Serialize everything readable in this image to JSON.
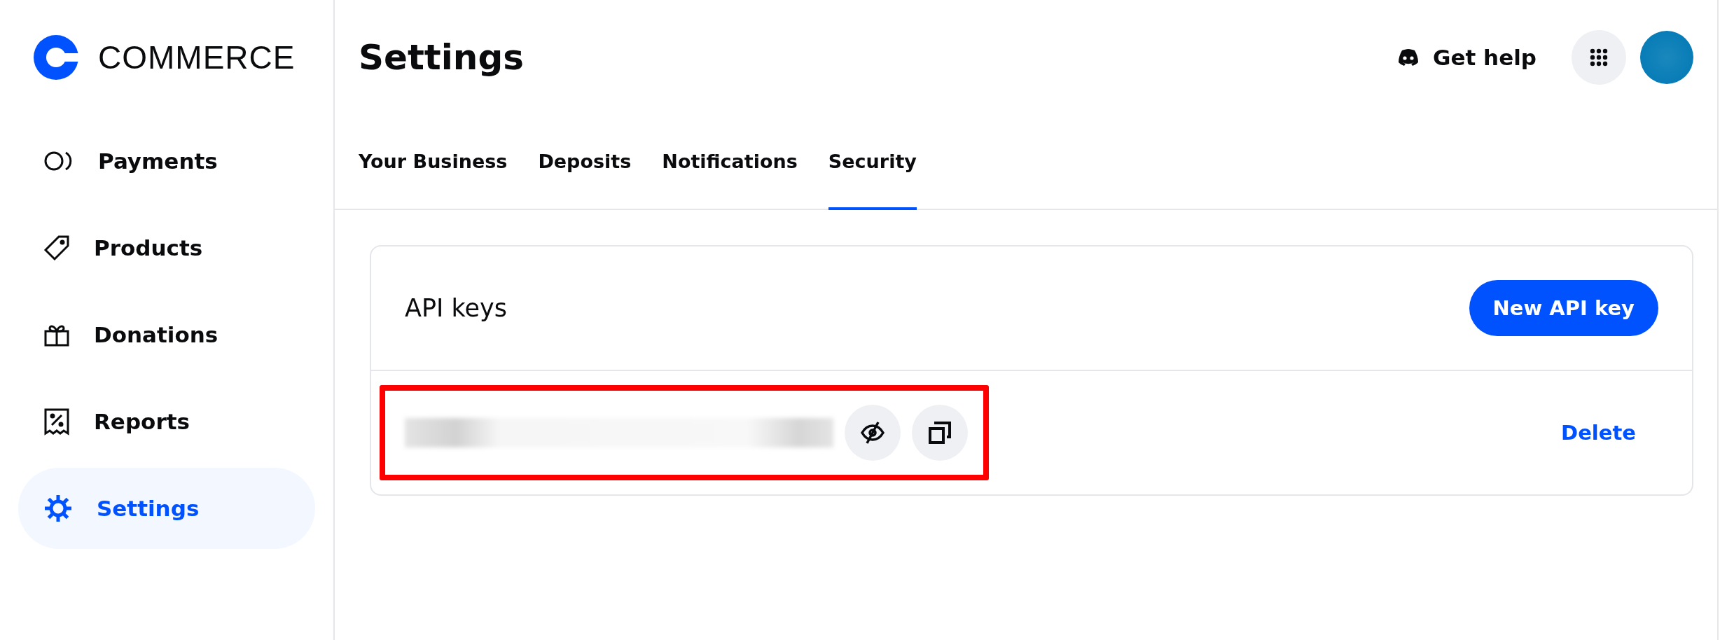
{
  "brand": {
    "name": "COMMERCE"
  },
  "sidebar": {
    "items": [
      {
        "label": "Payments",
        "kind": "payments",
        "selected": false
      },
      {
        "label": "Products",
        "kind": "products",
        "selected": false
      },
      {
        "label": "Donations",
        "kind": "donations",
        "selected": false
      },
      {
        "label": "Reports",
        "kind": "reports",
        "selected": false
      },
      {
        "label": "Settings",
        "kind": "settings",
        "selected": true
      }
    ]
  },
  "header": {
    "title": "Settings",
    "help": "Get help"
  },
  "tabs": [
    {
      "label": "Your Business",
      "selected": false
    },
    {
      "label": "Deposits",
      "selected": false
    },
    {
      "label": "Notifications",
      "selected": false
    },
    {
      "label": "Security",
      "selected": true
    }
  ],
  "api_keys": {
    "title": "API keys",
    "new_button": "New API key",
    "keys": [
      {
        "hidden": true,
        "delete": "Delete",
        "highlighted": true
      }
    ]
  }
}
